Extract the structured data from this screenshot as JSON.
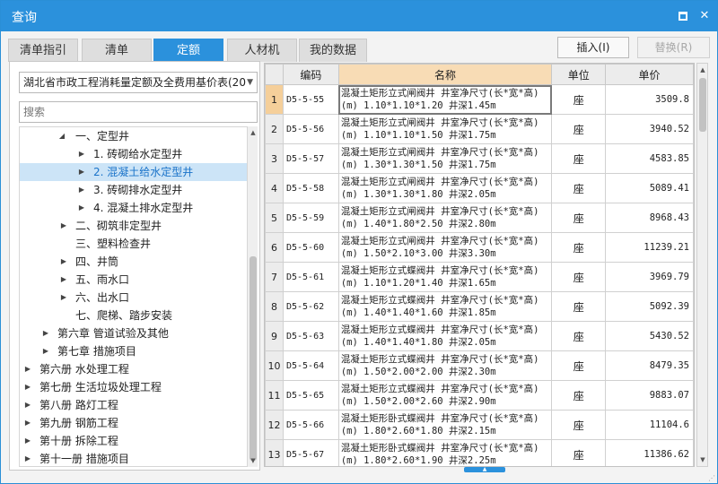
{
  "window": {
    "title": "查询",
    "maximize_icon": "maximize-icon",
    "close_icon": "close-icon",
    "close_glyph": "✕"
  },
  "tabs": [
    {
      "label": "清单指引",
      "active": false
    },
    {
      "label": "清单",
      "active": false
    },
    {
      "label": "定额",
      "active": true
    },
    {
      "label": "人材机",
      "active": false
    },
    {
      "label": "我的数据",
      "active": false
    }
  ],
  "buttons": {
    "insert_label": "插入(I)",
    "replace_label": "替换(R)"
  },
  "left": {
    "dropdown_value": "湖北省市政工程消耗量定额及全费用基价表(20",
    "search_placeholder": "搜索"
  },
  "tree": [
    {
      "label": "一、定型井",
      "expander": "▲",
      "level": 3
    },
    {
      "label": "1. 砖砌给水定型井",
      "expander": "▶",
      "level": 4
    },
    {
      "label": "2. 混凝土给水定型井",
      "expander": "▶",
      "level": 4,
      "selected": true
    },
    {
      "label": "3. 砖砌排水定型井",
      "expander": "▶",
      "level": 4
    },
    {
      "label": "4. 混凝土排水定型井",
      "expander": "▶",
      "level": 4
    },
    {
      "label": "二、砌筑非定型井",
      "expander": "▶",
      "level": 3
    },
    {
      "label": "三、塑料检查井",
      "expander": "",
      "level": 3
    },
    {
      "label": "四、井筒",
      "expander": "▶",
      "level": 3
    },
    {
      "label": "五、雨水口",
      "expander": "▶",
      "level": 3
    },
    {
      "label": "六、出水口",
      "expander": "▶",
      "level": 3
    },
    {
      "label": "七、爬梯、踏步安装",
      "expander": "",
      "level": 3
    },
    {
      "label": "第六章 管道试验及其他",
      "expander": "▶",
      "level": 2
    },
    {
      "label": "第七章 措施项目",
      "expander": "▶",
      "level": 2
    },
    {
      "label": "第六册 水处理工程",
      "expander": "▶",
      "level": 1
    },
    {
      "label": "第七册 生活垃圾处理工程",
      "expander": "▶",
      "level": 1
    },
    {
      "label": "第八册 路灯工程",
      "expander": "▶",
      "level": 1
    },
    {
      "label": "第九册 钢筋工程",
      "expander": "▶",
      "level": 1
    },
    {
      "label": "第十册 拆除工程",
      "expander": "▶",
      "level": 1
    },
    {
      "label": "第十一册 措施项目",
      "expander": "▶",
      "level": 1
    }
  ],
  "grid": {
    "headers": {
      "code": "编码",
      "name": "名称",
      "unit": "单位",
      "price": "单价"
    },
    "rows": [
      {
        "idx": "1",
        "code": "D5-5-55",
        "name": "混凝土矩形立式闸阀井 井室净尺寸(长*宽*高)(m) 1.10*1.10*1.20 井深1.45m",
        "unit": "座",
        "price": "3509.8"
      },
      {
        "idx": "2",
        "code": "D5-5-56",
        "name": "混凝土矩形立式闸阀井 井室净尺寸(长*宽*高)(m) 1.10*1.10*1.50 井深1.75m",
        "unit": "座",
        "price": "3940.52"
      },
      {
        "idx": "3",
        "code": "D5-5-57",
        "name": "混凝土矩形立式闸阀井 井室净尺寸(长*宽*高)(m) 1.30*1.30*1.50 井深1.75m",
        "unit": "座",
        "price": "4583.85"
      },
      {
        "idx": "4",
        "code": "D5-5-58",
        "name": "混凝土矩形立式闸阀井 井室净尺寸(长*宽*高)(m) 1.30*1.30*1.80 井深2.05m",
        "unit": "座",
        "price": "5089.41"
      },
      {
        "idx": "5",
        "code": "D5-5-59",
        "name": "混凝土矩形立式闸阀井 井室净尺寸(长*宽*高)(m) 1.40*1.80*2.50 井深2.80m",
        "unit": "座",
        "price": "8968.43"
      },
      {
        "idx": "6",
        "code": "D5-5-60",
        "name": "混凝土矩形立式闸阀井 井室净尺寸(长*宽*高)(m) 1.50*2.10*3.00 井深3.30m",
        "unit": "座",
        "price": "11239.21"
      },
      {
        "idx": "7",
        "code": "D5-5-61",
        "name": "混凝土矩形立式蝶阀井 井室净尺寸(长*宽*高)(m) 1.10*1.20*1.40 井深1.65m",
        "unit": "座",
        "price": "3969.79"
      },
      {
        "idx": "8",
        "code": "D5-5-62",
        "name": "混凝土矩形立式蝶阀井 井室净尺寸(长*宽*高)(m) 1.40*1.40*1.60 井深1.85m",
        "unit": "座",
        "price": "5092.39"
      },
      {
        "idx": "9",
        "code": "D5-5-63",
        "name": "混凝土矩形立式蝶阀井 井室净尺寸(长*宽*高)(m) 1.40*1.40*1.80 井深2.05m",
        "unit": "座",
        "price": "5430.52"
      },
      {
        "idx": "10",
        "code": "D5-5-64",
        "name": "混凝土矩形立式蝶阀井 井室净尺寸(长*宽*高)(m) 1.50*2.00*2.00 井深2.30m",
        "unit": "座",
        "price": "8479.35"
      },
      {
        "idx": "11",
        "code": "D5-5-65",
        "name": "混凝土矩形立式蝶阀井 井室净尺寸(长*宽*高)(m) 1.50*2.00*2.60 井深2.90m",
        "unit": "座",
        "price": "9883.07"
      },
      {
        "idx": "12",
        "code": "D5-5-66",
        "name": "混凝土矩形卧式蝶阀井 井室净尺寸(长*宽*高)(m) 1.80*2.60*1.80 井深2.15m",
        "unit": "座",
        "price": "11104.6"
      },
      {
        "idx": "13",
        "code": "D5-5-67",
        "name": "混凝土矩形卧式蝶阀井 井室净尺寸(长*宽*高)(m) 1.80*2.60*1.90 井深2.25m",
        "unit": "座",
        "price": "11386.62"
      }
    ]
  },
  "colors": {
    "accent": "#2b91dc",
    "name_header": "#f8dcb5",
    "selected_tree": "#cce4f7"
  }
}
